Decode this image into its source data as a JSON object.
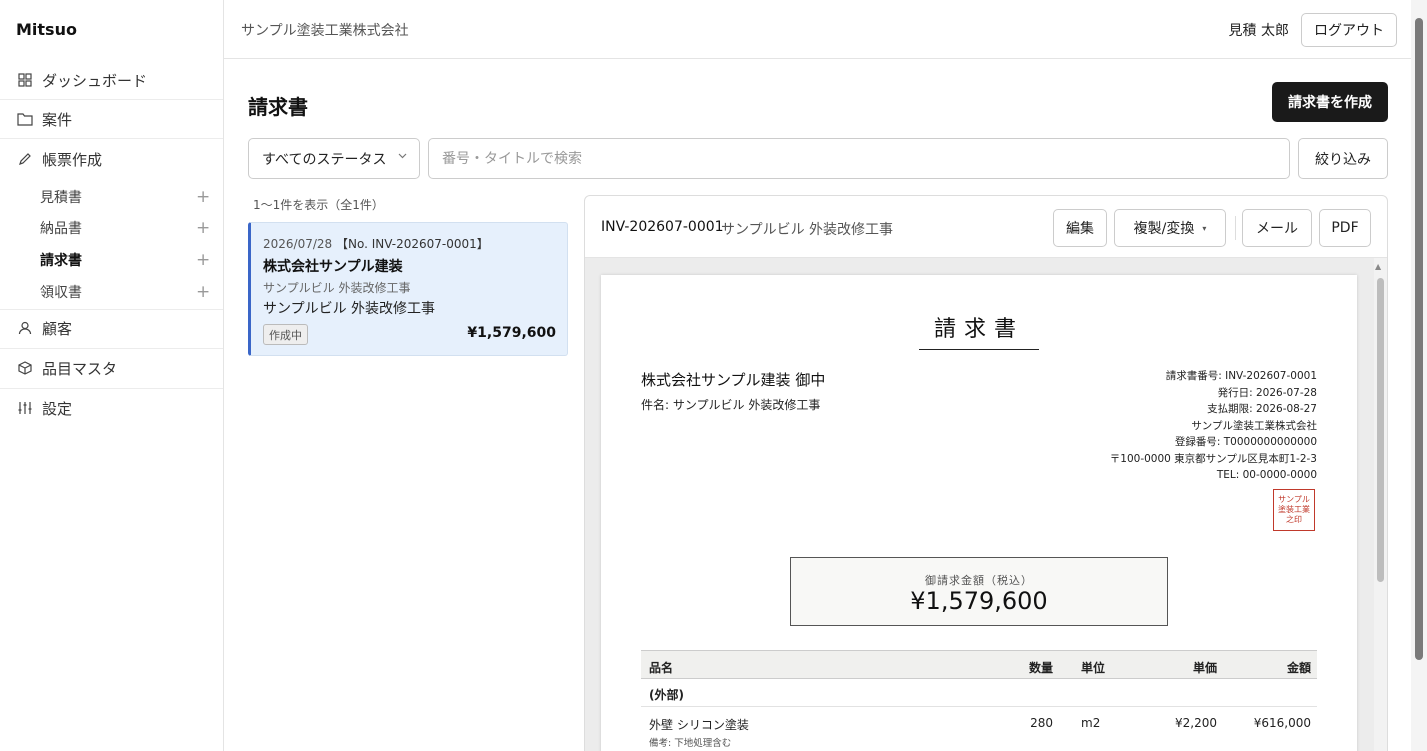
{
  "sidebar": {
    "brand": "Mitsuo",
    "dashboard": "ダッシュボード",
    "projects": "案件",
    "documents": "帳票作成",
    "sub": [
      {
        "label": "見積書"
      },
      {
        "label": "納品書"
      },
      {
        "label": "請求書"
      },
      {
        "label": "領収書"
      }
    ],
    "customers": "顧客",
    "items_master": "品目マスタ",
    "settings": "設定"
  },
  "topbar": {
    "company": "サンプル塗装工業株式会社",
    "user": "見積 太郎",
    "logout": "ログアウト"
  },
  "main": {
    "title": "請求書",
    "create_button": "請求書を作成",
    "status_select": "すべてのステータス",
    "search_placeholder": "番号・タイトルで検索",
    "filter_button": "絞り込み",
    "count_text": "1〜1件を表示（全1件）"
  },
  "list": [
    {
      "date": "2026/07/28",
      "number": "【No. INV-202607-0001】",
      "client": "株式会社サンプル建装",
      "client_sub": "サンプルビル 外装改修工事",
      "title": "サンプルビル 外装改修工事",
      "status": "作成中",
      "amount": "¥1,579,600"
    }
  ],
  "preview": {
    "number": "INV-202607-0001",
    "name": "サンプルビル 外装改修工事",
    "edit": "編集",
    "duplicate": "複製/変換",
    "mail": "メール",
    "pdf": "PDF",
    "doc": {
      "title": "請求書",
      "client": "株式会社サンプル建装 御中",
      "subject": "件名: サンプルビル 外装改修工事",
      "issuer": [
        "請求書番号: INV-202607-0001",
        "発行日: 2026-07-28",
        "支払期限: 2026-08-27",
        "サンプル塗装工業株式会社",
        "登録番号: T0000000000000",
        "〒100-0000 東京都サンプル区見本町1-2-3",
        "TEL: 00-0000-0000"
      ],
      "seal": "サンプル塗装工業之印",
      "total_label": "御請求金額（税込）",
      "total": "¥1,579,600",
      "table_headers": {
        "name": "品名",
        "qty": "数量",
        "unit": "単位",
        "price": "単価",
        "amount": "金額"
      },
      "group": "(外部)",
      "rows": [
        {
          "name": "外壁 シリコン塗装",
          "qty": "280",
          "unit": "m2",
          "price": "¥2,200",
          "amount": "¥616,000",
          "note": "備考: 下地処理含む"
        }
      ]
    }
  }
}
